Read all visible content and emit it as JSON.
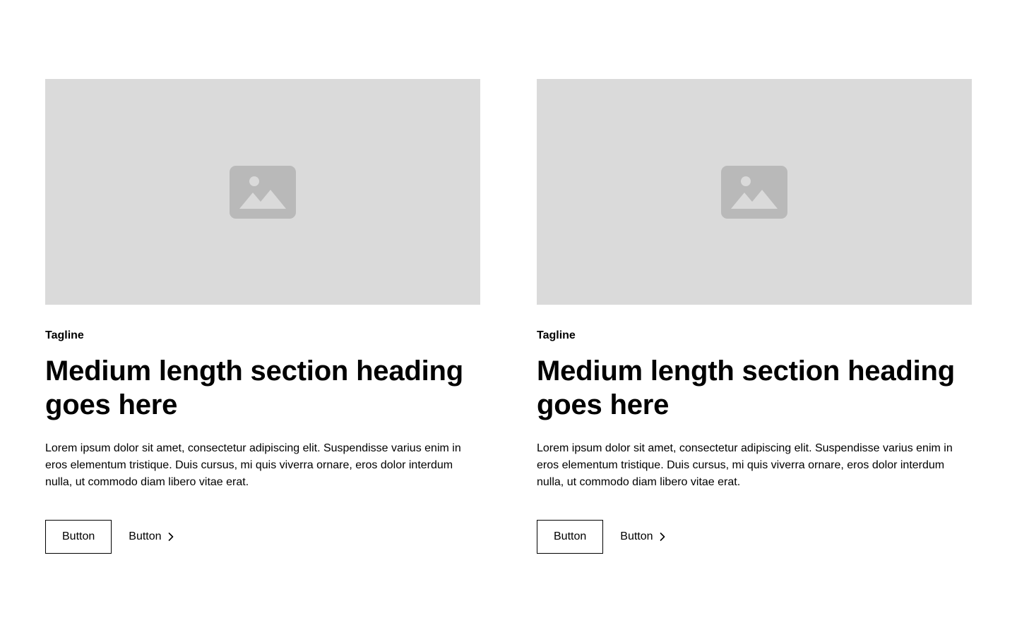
{
  "colors": {
    "background": "#ffffff",
    "text": "#000000",
    "image_placeholder_bg": "#dadada",
    "image_icon": "#b9b9b9",
    "button_border": "#000000"
  },
  "cards": [
    {
      "image": {
        "icon": "image-placeholder-icon"
      },
      "tagline": "Tagline",
      "heading": "Medium length section heading goes here",
      "body": "Lorem ipsum dolor sit amet, consectetur adipiscing elit. Suspendisse varius enim in eros elementum tristique. Duis cursus, mi quis viverra ornare, eros dolor interdum nulla, ut commodo diam libero vitae erat.",
      "primary_button": "Button",
      "link_button": {
        "label": "Button",
        "icon": "chevron-right-icon"
      }
    },
    {
      "image": {
        "icon": "image-placeholder-icon"
      },
      "tagline": "Tagline",
      "heading": "Medium length section heading goes here",
      "body": "Lorem ipsum dolor sit amet, consectetur adipiscing elit. Suspendisse varius enim in eros elementum tristique. Duis cursus, mi quis viverra ornare, eros dolor interdum nulla, ut commodo diam libero vitae erat.",
      "primary_button": "Button",
      "link_button": {
        "label": "Button",
        "icon": "chevron-right-icon"
      }
    }
  ]
}
